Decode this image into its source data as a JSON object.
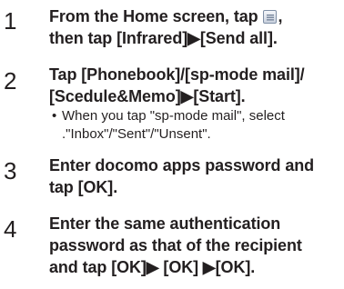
{
  "steps": [
    {
      "number": "1",
      "lines": [
        {
          "before": "From the Home screen, tap ",
          "after": ","
        },
        {
          "text": "then tap [Infrared]▶[Send all]."
        }
      ]
    },
    {
      "number": "2",
      "lines": [
        {
          "text": "Tap [Phonebook]/[sp-mode mail]/"
        },
        {
          "text": "[Scedule&Memo]▶[Start]."
        }
      ],
      "note": {
        "bullet": "•",
        "lines": [
          "When you tap \"sp-mode mail\", select",
          ".\"Inbox\"/\"Sent\"/\"Unsent\"."
        ]
      }
    },
    {
      "number": "3",
      "lines": [
        {
          "text": "Enter docomo apps password and"
        },
        {
          "text": "tap [OK]."
        }
      ]
    },
    {
      "number": "4",
      "lines": [
        {
          "text": "Enter the same authentication"
        },
        {
          "text": "password as that of the recipient"
        },
        {
          "text": "and tap [OK]▶  [OK]  ▶[OK]."
        }
      ]
    }
  ],
  "icons": {
    "menu_icon": "menu-icon"
  },
  "colors": {
    "text": "#231f20",
    "icon_border": "#7f8fa6"
  }
}
